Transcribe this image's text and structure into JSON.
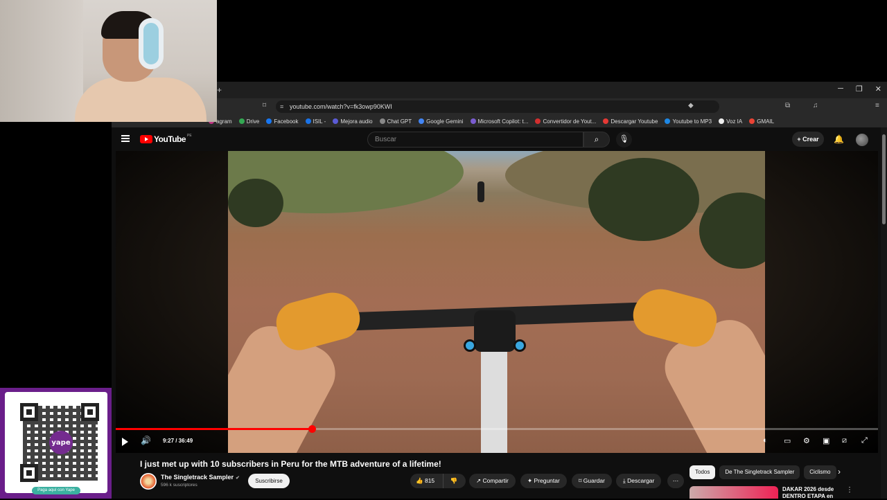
{
  "browser": {
    "url": "youtube.com/watch?v=fk3owp90KWI",
    "bookmarks": [
      "agram",
      "Drive",
      "Facebook",
      "ISIL -",
      "Mejora audio",
      "Chat GPT",
      "Google Gemini",
      "Microsoft Copilot: t...",
      "Convertidor de Yout...",
      "Descargar Youtube",
      "Youtube to MP3",
      "Voz IA",
      "GMAIL"
    ]
  },
  "youtube": {
    "logo": "YouTube",
    "region": "PE",
    "search_placeholder": "Buscar",
    "create_label": "Crear"
  },
  "player": {
    "time": "9:27 / 36:49",
    "progress": 0.257
  },
  "video": {
    "title": "I just met up with 10 subscribers in Peru for the MTB adventure of a lifetime!",
    "channel": "The Singletrack Sampler",
    "subscribers": "596 k suscriptores",
    "subscribe": "Suscribirse",
    "likes": "815",
    "share": "Compartir",
    "ask": "Preguntar",
    "save": "Guardar",
    "download": "Descargar"
  },
  "sidebar": {
    "chips": [
      "Todos",
      "De The Singletrack Sampler",
      "Ciclismo"
    ],
    "rec_title": "DAKAR 2026 desde DENTRO ETAPA en"
  },
  "colors": {
    "accent": "#ff0000",
    "bg": "#0f0f0f",
    "yape": "#6a1e8a"
  }
}
